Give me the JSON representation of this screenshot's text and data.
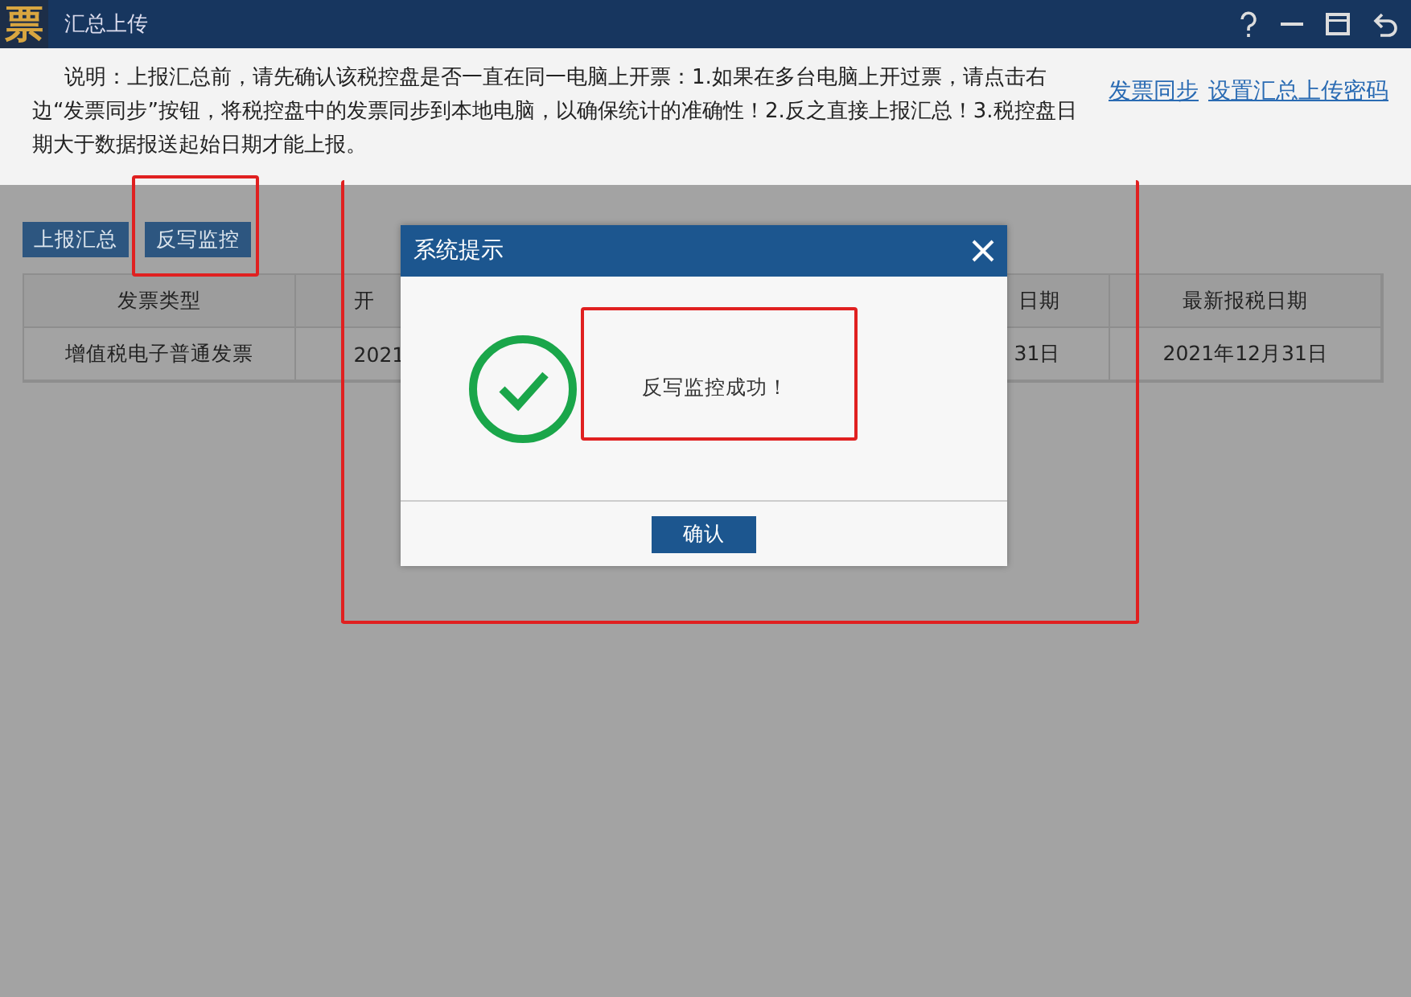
{
  "window": {
    "title": "汇总上传",
    "logo": "票"
  },
  "notice": {
    "text": "说明：上报汇总前，请先确认该税控盘是否一直在同一电脑上开票：1.如果在多台电脑上开过票，请点击右边“发票同步”按钮，将税控盘中的发票同步到本地电脑，以确保统计的准确性！2.反之直接上报汇总！3.税控盘日期大于数据报送起始日期才能上报。",
    "links": [
      "发票同步",
      "设置汇总上传密码"
    ]
  },
  "toolbar": [
    "上报汇总",
    "反写监控"
  ],
  "table": {
    "columns": [
      "发票类型",
      "开",
      "",
      "日期",
      "最新报税日期"
    ],
    "rows": [
      [
        "增值税电子普通发票",
        "2021",
        "",
        "31日",
        "2021年12月31日"
      ]
    ]
  },
  "dialog": {
    "title": "系统提示",
    "message": "反写监控成功！",
    "button": "确认"
  }
}
